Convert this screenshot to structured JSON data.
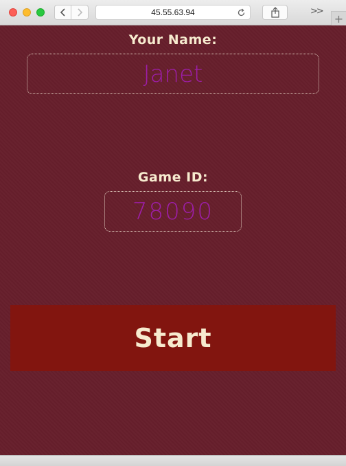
{
  "browser": {
    "url": "45.55.63.94",
    "overflow_label": ">>",
    "new_tab_label": "+"
  },
  "form": {
    "name_label": "Your Name:",
    "name_value": "Janet",
    "game_label": "Game ID:",
    "game_value": "78090",
    "start_label": "Start"
  },
  "colors": {
    "page_background": "#671f2c",
    "button_background": "#82150f",
    "label_text": "#f7ebcf",
    "input_text": "#9d1ea8"
  }
}
